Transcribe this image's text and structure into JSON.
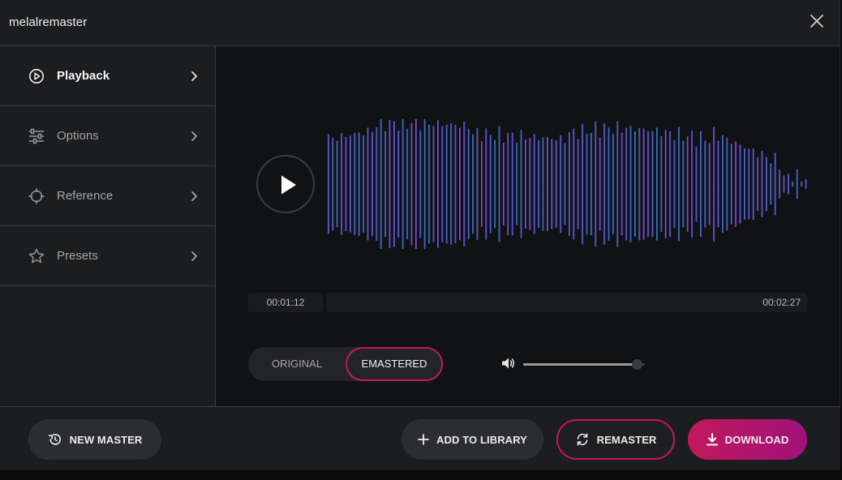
{
  "app": {
    "title": "melalremaster"
  },
  "colors": {
    "accent": "#c2185b",
    "accent_end": "#a0127a",
    "wave_start": "#2a9bd6",
    "wave_mid": "#4b4fc4",
    "wave_end": "#7a1a8a"
  },
  "sidebar": {
    "items": [
      {
        "label": "Playback",
        "icon": "play-circle-icon",
        "active": true
      },
      {
        "label": "Options",
        "icon": "sliders-icon",
        "active": false
      },
      {
        "label": "Reference",
        "icon": "crosshair-icon",
        "active": false
      },
      {
        "label": "Presets",
        "icon": "star-icon",
        "active": false
      }
    ]
  },
  "player": {
    "current_time": "00:01:12",
    "total_time": "00:02:27",
    "progress": 0.0,
    "volume": 0.93,
    "toggle": {
      "original": "ORIGINAL",
      "remastered": "EMASTERED",
      "selected": "remastered"
    }
  },
  "footer": {
    "new_master": "NEW MASTER",
    "add_to_library": "ADD TO LIBRARY",
    "remaster": "REMASTER",
    "download": "DOWNLOAD"
  }
}
